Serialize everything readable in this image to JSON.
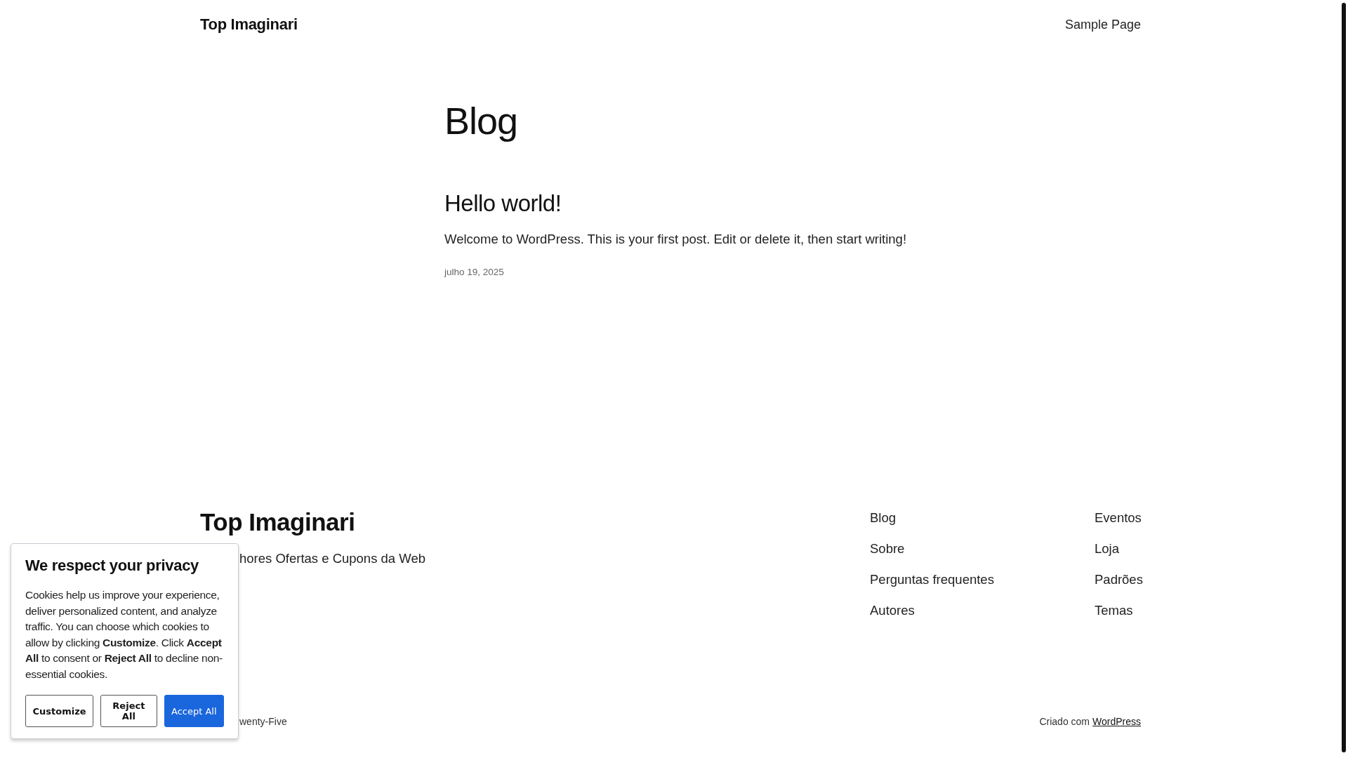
{
  "header": {
    "site_title": "Top Imaginari",
    "nav": [
      "Sample Page"
    ]
  },
  "page_title": "Blog",
  "posts": [
    {
      "title": "Hello world!",
      "excerpt": "Welcome to WordPress. This is your first post. Edit or delete it, then start writing!",
      "date": "julho 19, 2025"
    }
  ],
  "footer": {
    "site_title": "Top Imaginari",
    "tagline": "hores Ofertas e Cupons da Web",
    "nav_columns": [
      [
        "Blog",
        "Sobre",
        "Perguntas frequentes",
        "Autores"
      ],
      [
        "Eventos",
        "Loja",
        "Padrões",
        "Temas"
      ]
    ],
    "theme_credit": "wenty-Five",
    "credit_prefix": "Criado com",
    "credit_link": "WordPress"
  },
  "cookie_banner": {
    "title": "We respect your privacy",
    "text": "Cookies help us improve your experience, deliver personalized content, and analyze traffic. You can choose which cookies to allow by clicking **Customize**. Click **Accept All** to consent or **Reject All** to decline non-essential cookies.",
    "buttons": [
      {
        "label": "Customize",
        "kind": "secondary"
      },
      {
        "label": "Reject All",
        "kind": "secondary"
      },
      {
        "label": "Accept All",
        "kind": "primary"
      }
    ]
  }
}
